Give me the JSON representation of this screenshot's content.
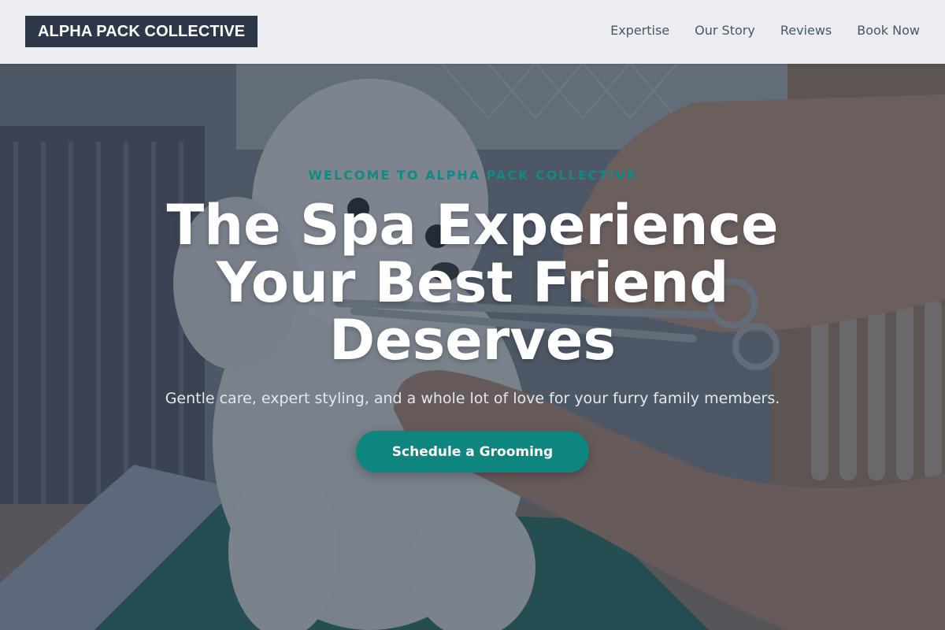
{
  "header": {
    "logo_text": "ALPHA PACK COLLECTIVE",
    "nav_items": [
      {
        "label": "Expertise"
      },
      {
        "label": "Our Story"
      },
      {
        "label": "Reviews"
      },
      {
        "label": "Book Now"
      }
    ]
  },
  "hero": {
    "eyebrow": "WELCOME TO ALPHA PACK COLLECTIVE",
    "title_line_1": "The Spa Experience",
    "title_line_2": "Your Best Friend",
    "title_line_3": "Deserves",
    "subtitle": "Gentle care, expert styling, and a whole lot of love for your furry family members.",
    "cta_label": "Schedule a Grooming"
  },
  "colors": {
    "accent": "#0f8580",
    "eyebrow": "#0f8a87",
    "logo_bg": "#2d3748",
    "header_bg": "#f3f4f6",
    "nav_text": "#4a5568"
  }
}
